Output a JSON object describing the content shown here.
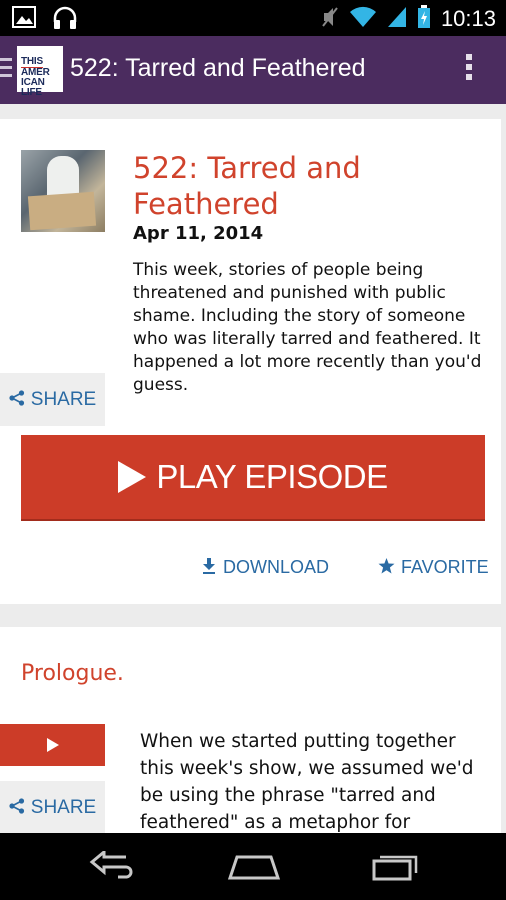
{
  "status_bar": {
    "time": "10:13",
    "icons": [
      "gallery-icon",
      "headphones-icon",
      "mute-icon",
      "wifi-icon",
      "signal-icon",
      "battery-icon"
    ]
  },
  "action_bar": {
    "logo_lines": [
      "THIS",
      "AMER",
      "ICAN",
      "LIFE"
    ],
    "title": "522: Tarred and Feathered"
  },
  "episode": {
    "title": "522: Tarred and Feathered",
    "date": "Apr 11, 2014",
    "description": "This week, stories of people being threatened and punished with public shame. Including the story of someone who was literally tarred and feathered. It happened a lot more recently than you'd guess.",
    "share_label": "SHARE",
    "play_label": "PLAY EPISODE",
    "download_label": "DOWNLOAD",
    "favorite_label": "FAVORITE"
  },
  "act": {
    "title": "Prologue.",
    "description": "When we started putting together this week's show, we assumed we'd be using the phrase \"tarred and feathered\" as a metaphor for",
    "share_label": "SHARE"
  },
  "colors": {
    "accent_red": "#cc3c28",
    "title_red": "#d0432c",
    "link_blue": "#2a6aa3",
    "actionbar_purple": "#4b2c5f"
  },
  "nav_bar": {
    "icons": [
      "back-icon",
      "home-icon",
      "recent-apps-icon"
    ]
  }
}
